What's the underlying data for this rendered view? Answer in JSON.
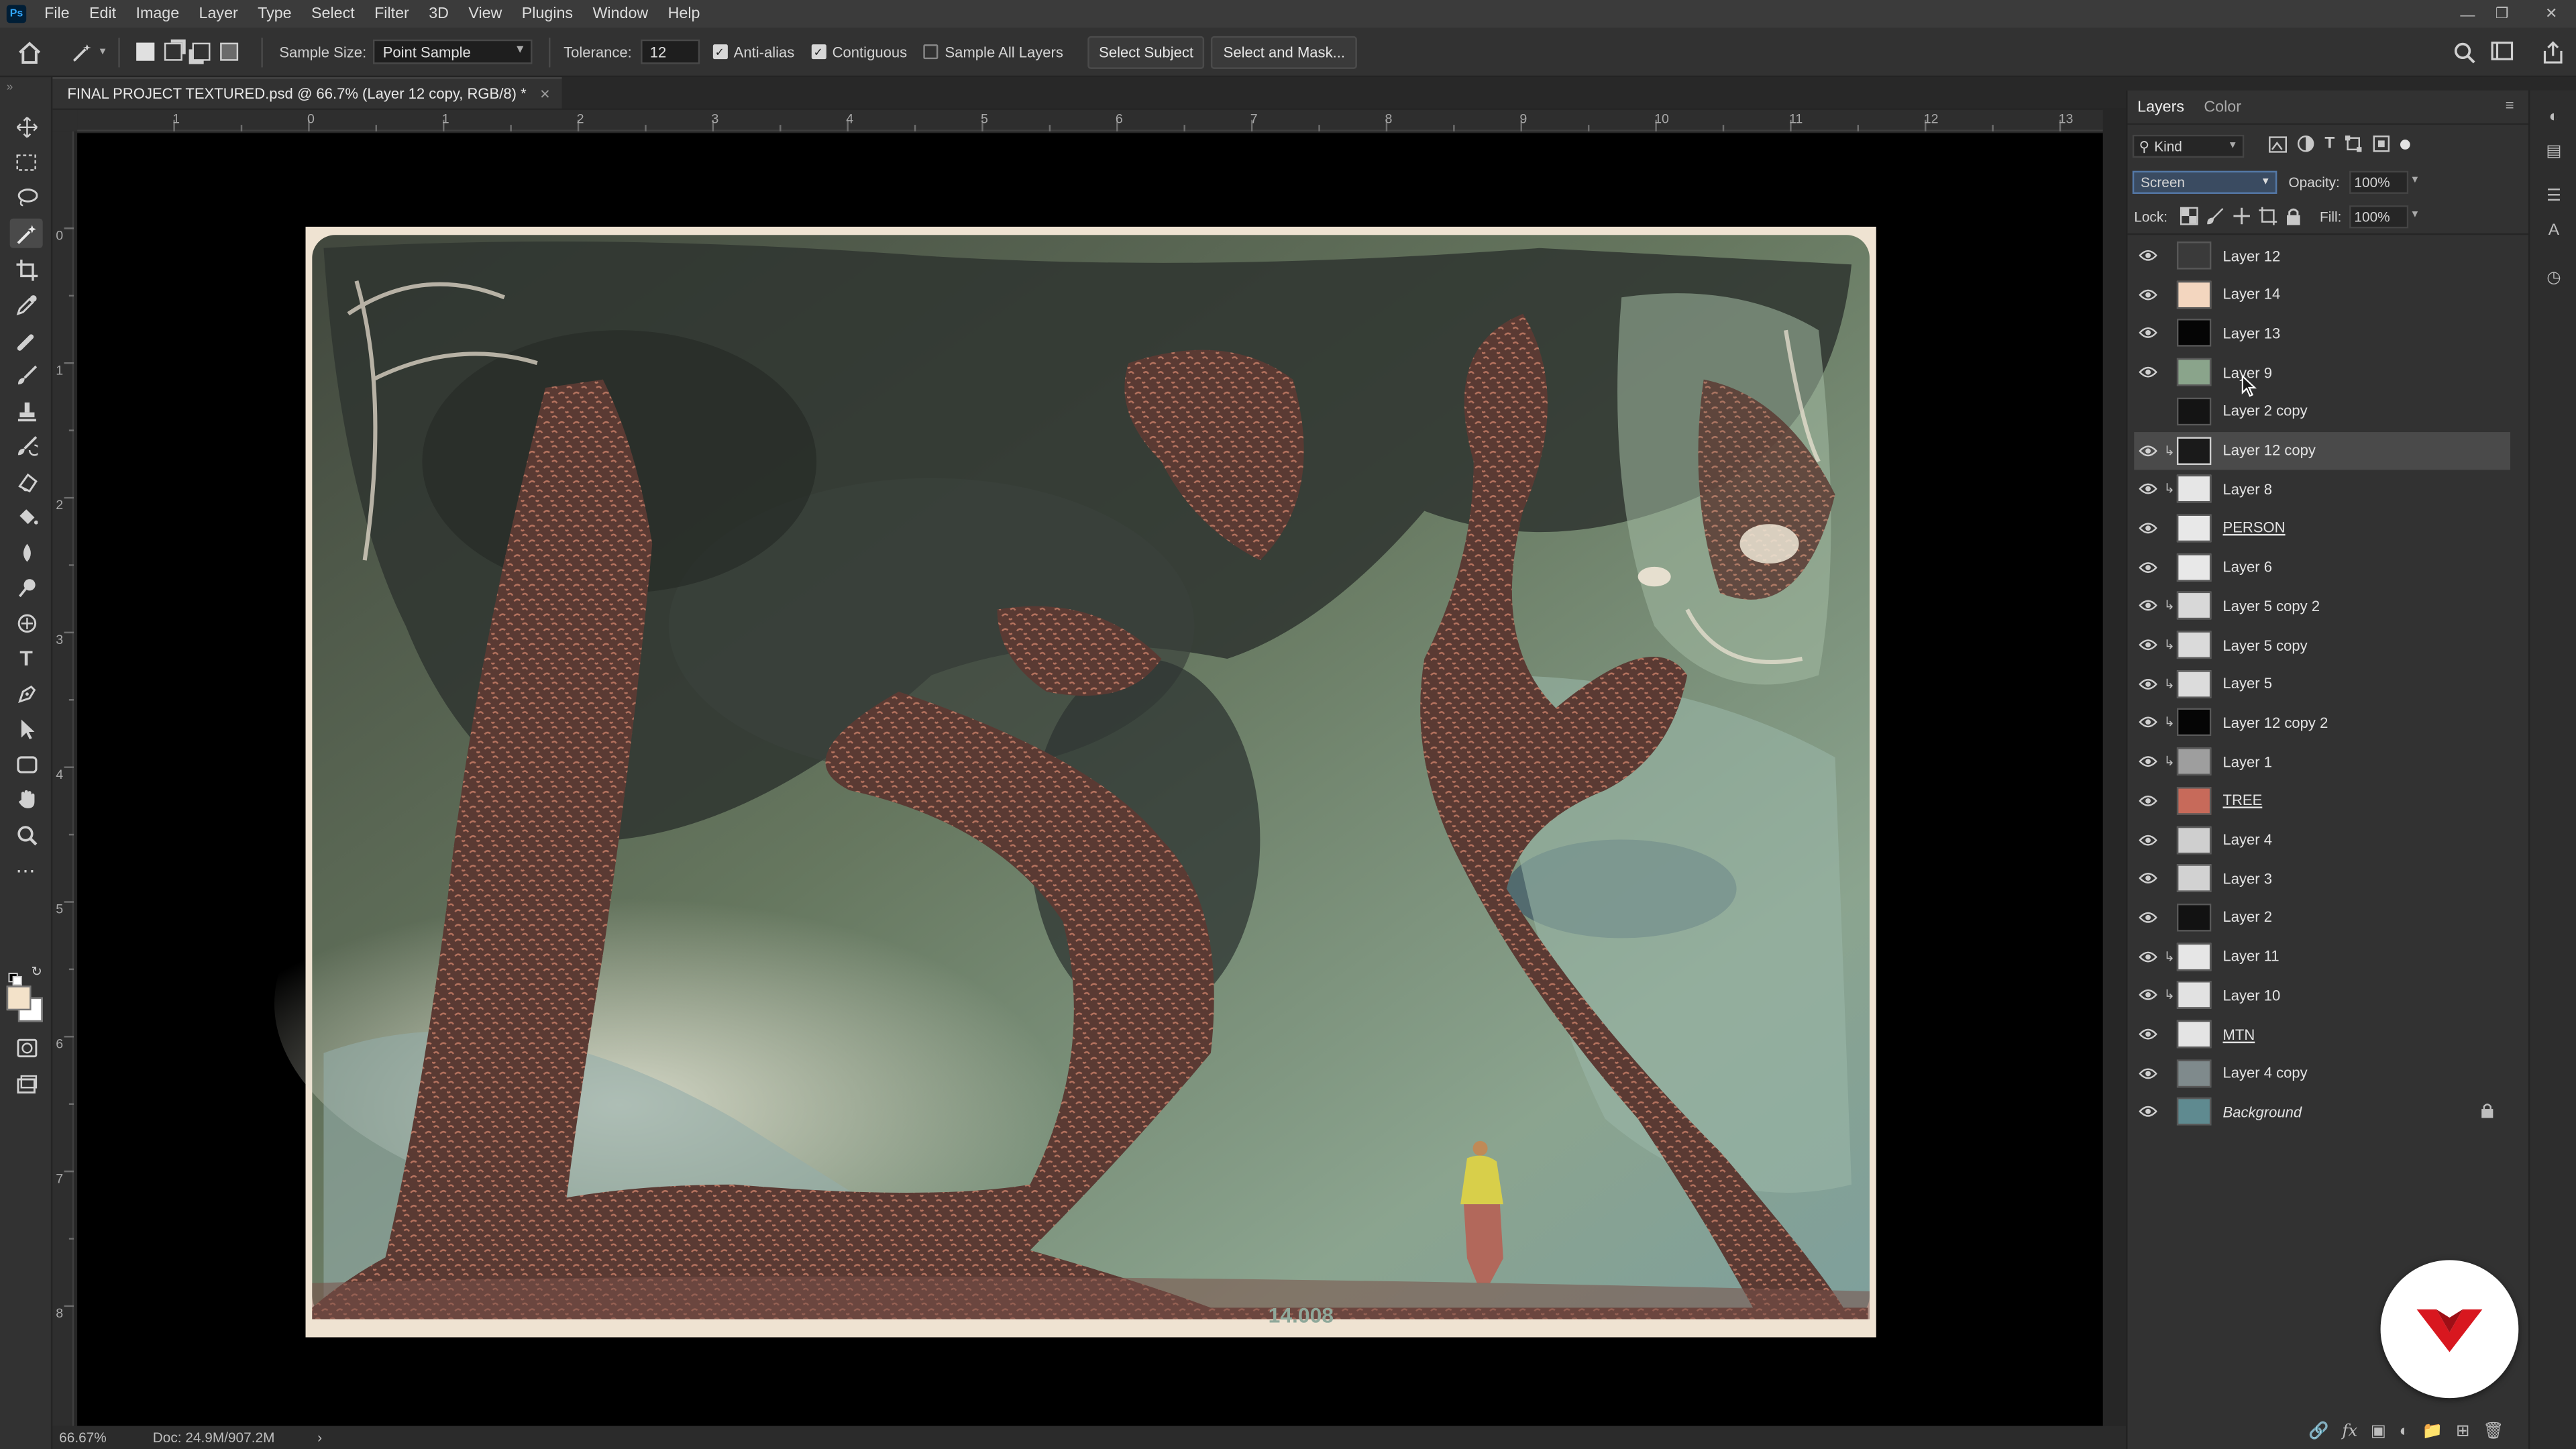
{
  "app": {
    "logo_text": "Ps"
  },
  "menu": [
    "File",
    "Edit",
    "Image",
    "Layer",
    "Type",
    "Select",
    "Filter",
    "3D",
    "View",
    "Plugins",
    "Window",
    "Help"
  ],
  "options": {
    "sample_size_label": "Sample Size:",
    "sample_size_value": "Point Sample",
    "tolerance_label": "Tolerance:",
    "tolerance_value": "12",
    "anti_alias_label": "Anti-alias",
    "anti_alias_checked": true,
    "contiguous_label": "Contiguous",
    "contiguous_checked": true,
    "sample_all_layers_label": "Sample All Layers",
    "sample_all_layers_checked": false,
    "select_subject_label": "Select Subject",
    "select_and_mask_label": "Select and Mask..."
  },
  "document": {
    "tab_title": "FINAL PROJECT TEXTURED.psd @ 66.7% (Layer 12 copy, RGB/8) *",
    "ruler_h_labels": [
      "1",
      "0",
      "1",
      "2",
      "3",
      "4",
      "5",
      "6",
      "7",
      "8",
      "9",
      "10",
      "11",
      "12",
      "13"
    ],
    "ruler_v_labels": [
      "0",
      "1",
      "2",
      "3",
      "4",
      "5",
      "6",
      "7",
      "8"
    ],
    "artwork_text": "14.008"
  },
  "status": {
    "zoom": "66.67%",
    "doc_size": "Doc: 24.9M/907.2M",
    "arrow": "›"
  },
  "layers_panel": {
    "tab_layers": "Layers",
    "tab_color": "Color",
    "filter_kind": "Kind",
    "blend_mode": "Screen",
    "opacity_label": "Opacity:",
    "opacity_value": "100%",
    "lock_label": "Lock:",
    "fill_label": "Fill:",
    "fill_value": "100%",
    "layers": [
      {
        "name": "Layer 12",
        "visible": true,
        "clipped": false,
        "thumb": "#3a3a3a",
        "style": ""
      },
      {
        "name": "Layer 14",
        "visible": true,
        "clipped": false,
        "thumb": "#f3d6bf",
        "style": ""
      },
      {
        "name": "Layer 13",
        "visible": true,
        "clipped": false,
        "thumb": "#050505",
        "style": ""
      },
      {
        "name": "Layer 9",
        "visible": true,
        "clipped": false,
        "thumb": "#8aa48b",
        "style": ""
      },
      {
        "name": "Layer 2 copy",
        "visible": false,
        "clipped": false,
        "thumb": "#141414",
        "style": ""
      },
      {
        "name": "Layer 12 copy",
        "visible": true,
        "clipped": true,
        "thumb": "#1a1a1a",
        "style": "",
        "selected": true
      },
      {
        "name": "Layer 8",
        "visible": true,
        "clipped": true,
        "thumb": "#e6e6e6",
        "style": ""
      },
      {
        "name": "PERSON",
        "visible": true,
        "clipped": false,
        "thumb": "#e8e8e8",
        "style": "ul"
      },
      {
        "name": "Layer 6",
        "visible": true,
        "clipped": false,
        "thumb": "#e8e8e8",
        "style": ""
      },
      {
        "name": "Layer 5 copy 2",
        "visible": true,
        "clipped": true,
        "thumb": "#d8d8d8",
        "style": ""
      },
      {
        "name": "Layer 5 copy",
        "visible": true,
        "clipped": true,
        "thumb": "#dadada",
        "style": ""
      },
      {
        "name": "Layer 5",
        "visible": true,
        "clipped": true,
        "thumb": "#dcdcdc",
        "style": ""
      },
      {
        "name": "Layer 12 copy 2",
        "visible": true,
        "clipped": true,
        "thumb": "#050505",
        "style": ""
      },
      {
        "name": "Layer 1",
        "visible": true,
        "clipped": true,
        "thumb": "#9e9e9e",
        "style": ""
      },
      {
        "name": "TREE",
        "visible": true,
        "clipped": false,
        "thumb": "#c76a5a",
        "style": "ul"
      },
      {
        "name": "Layer 4",
        "visible": true,
        "clipped": false,
        "thumb": "#cfcfcf",
        "style": ""
      },
      {
        "name": "Layer 3",
        "visible": true,
        "clipped": false,
        "thumb": "#d2d2d2",
        "style": ""
      },
      {
        "name": "Layer 2",
        "visible": true,
        "clipped": false,
        "thumb": "#121212",
        "style": ""
      },
      {
        "name": "Layer 11",
        "visible": true,
        "clipped": true,
        "thumb": "#e6e6e6",
        "style": ""
      },
      {
        "name": "Layer 10",
        "visible": true,
        "clipped": true,
        "thumb": "#e2e2e2",
        "style": ""
      },
      {
        "name": "MTN",
        "visible": true,
        "clipped": false,
        "thumb": "#e4e4e4",
        "style": "ul"
      },
      {
        "name": "Layer 4 copy",
        "visible": true,
        "clipped": false,
        "thumb": "#7f8a8c",
        "style": ""
      },
      {
        "name": "Background",
        "visible": true,
        "clipped": false,
        "thumb": "#5f8a90",
        "style": "it",
        "locked": true
      }
    ]
  },
  "colors": {
    "accent_badge": "#d8171f",
    "canvas_bg": "#000000",
    "ui_bg": "#323232"
  }
}
